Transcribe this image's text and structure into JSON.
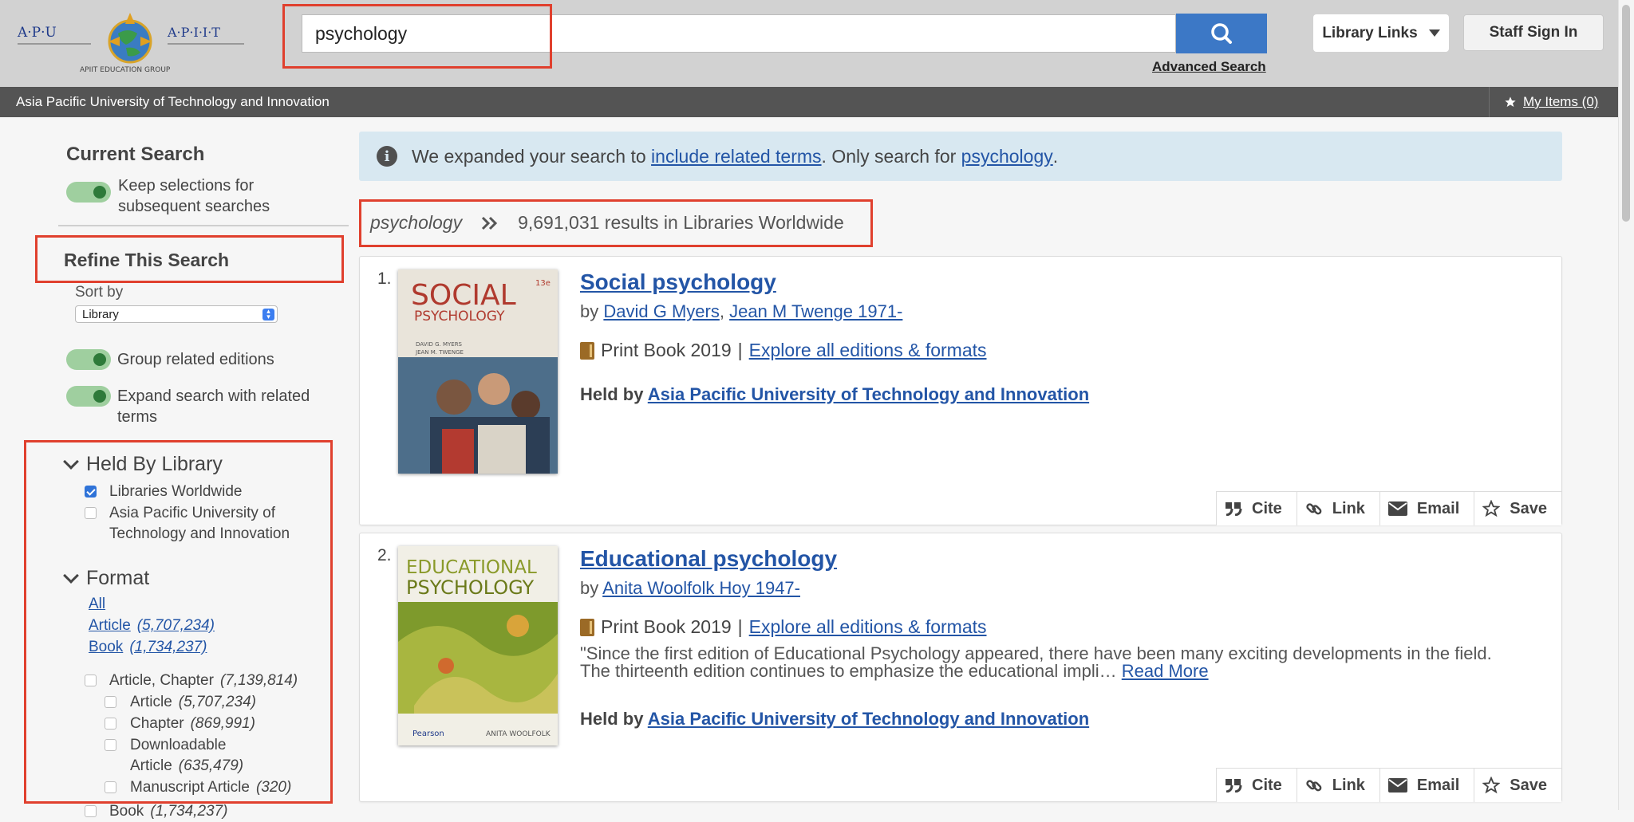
{
  "header": {
    "logo": {
      "left_text": "A·P·U",
      "right_text": "A·P·I·I·T",
      "bottom_text": "APIIT EDUCATION GROUP"
    },
    "search": {
      "value": "psychology"
    },
    "advanced_search": "Advanced Search",
    "library_links": "Library Links",
    "staff_sign_in": "Staff Sign In",
    "institution": "Asia Pacific University of Technology and Innovation",
    "my_items": "My Items (0)"
  },
  "sidebar": {
    "current_search": "Current Search",
    "keep_selections": "Keep selections for subsequent searches",
    "refine": "Refine This Search",
    "sort_by": "Sort by",
    "sort_value": "Library",
    "group_editions": "Group related editions",
    "expand_search": "Expand search with related terms",
    "held_by": {
      "title": "Held By Library",
      "options": [
        {
          "label": "Libraries Worldwide",
          "checked": true
        },
        {
          "label": "Asia Pacific University of Technology and Innovation",
          "checked": false
        }
      ]
    },
    "format": {
      "title": "Format",
      "all": "All",
      "quick": [
        {
          "label": "Article",
          "count": "(5,707,234)"
        },
        {
          "label": "Book",
          "count": "(1,734,237)"
        }
      ],
      "options": [
        {
          "label": "Article, Chapter",
          "count": "(7,139,814)"
        },
        {
          "label": "Article",
          "count": "(5,707,234)"
        },
        {
          "label": "Chapter",
          "count": "(869,991)"
        },
        {
          "label": "Downloadable",
          "label2": "Article",
          "count": "(635,479)"
        },
        {
          "label": "Manuscript Article",
          "count": "(320)"
        },
        {
          "label": "Book",
          "count": "(1,734,237)"
        }
      ]
    }
  },
  "notice": {
    "prefix": "We expanded your search to ",
    "link1": "include related terms",
    "middle": ". Only search for ",
    "link2": "psychology",
    "suffix": "."
  },
  "results": {
    "term": "psychology",
    "summary": "9,691,031 results in Libraries Worldwide",
    "items": [
      {
        "num": "1.",
        "title": "Social psychology",
        "by": "by",
        "authors": [
          "David G Myers",
          "Jean M Twenge 1971-"
        ],
        "format": "Print Book 2019",
        "sep": "|",
        "editions": "Explore all editions & formats",
        "held_label": "Held by",
        "held_by": "Asia Pacific University of Technology and Innovation",
        "cover": {
          "line1": "SOCIAL",
          "line2": "PSYCHOLOGY",
          "edition": "13e",
          "authors_line1": "DAVID G. MYERS",
          "authors_line2": "JEAN M. TWENGE"
        }
      },
      {
        "num": "2.",
        "title": "Educational psychology",
        "by": "by",
        "authors": [
          "Anita Woolfolk Hoy 1947-"
        ],
        "format": "Print Book 2019",
        "sep": "|",
        "editions": "Explore all editions & formats",
        "description": "\"Since the first edition of Educational Psychology appeared, there have been many exciting developments in the field. The thirteenth edition continues to emphasize the educational impli…",
        "read_more": "Read More",
        "held_label": "Held by",
        "held_by": "Asia Pacific University of Technology and Innovation",
        "cover": {
          "line1": "EDUCATIONAL",
          "line2": "PSYCHOLOGY",
          "publisher": "Pearson",
          "author": "ANITA WOOLFOLK"
        }
      }
    ],
    "actions": {
      "cite": "Cite",
      "link": "Link",
      "email": "Email",
      "save": "Save"
    }
  },
  "colors": {
    "accent": "#3c78c6",
    "link": "#2355a6",
    "highlight": "#e0402e",
    "toggle_on": "#9fcf9f"
  }
}
